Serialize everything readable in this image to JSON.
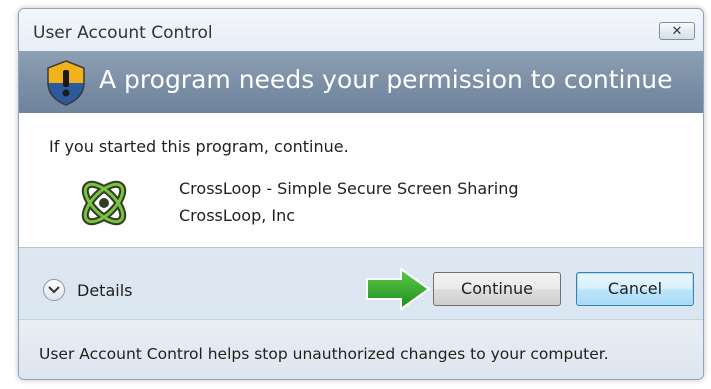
{
  "window": {
    "title": "User Account Control",
    "close_label": "✕"
  },
  "banner": {
    "icon": "uac-shield-icon",
    "title": "A program needs your permission to continue"
  },
  "content": {
    "intro": "If you started this program, continue.",
    "program": {
      "icon": "crossloop-logo-icon",
      "name": "CrossLoop - Simple Secure Screen Sharing",
      "publisher": "CrossLoop, Inc"
    }
  },
  "actions": {
    "details_label": "Details",
    "continue_label": "Continue",
    "cancel_label": "Cancel",
    "arrow_icon": "green-arrow-icon"
  },
  "footer": {
    "text": "User Account Control helps stop unauthorized changes to your computer."
  },
  "colors": {
    "banner": "#7a8ea5",
    "arrow": "#2fa82f",
    "cancel_border": "#3c7fb1"
  }
}
